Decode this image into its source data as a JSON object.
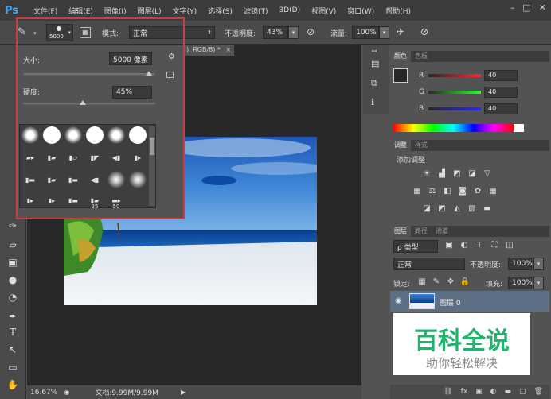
{
  "app": {
    "logo": "Ps"
  },
  "menu": [
    "文件(F)",
    "编辑(E)",
    "图像(I)",
    "图层(L)",
    "文字(Y)",
    "选择(S)",
    "滤镜(T)",
    "3D(D)",
    "视图(V)",
    "窗口(W)",
    "帮助(H)"
  ],
  "window_controls": [
    "–",
    "□",
    "✕"
  ],
  "options": {
    "brush_size": "5000",
    "mode_label": "模式:",
    "mode_value": "正常",
    "opacity_label": "不透明度:",
    "opacity_value": "43%",
    "flow_label": "流量:",
    "flow_value": "100%"
  },
  "document": {
    "tab_label": "), RGB/8) *",
    "zoom": "16.67%",
    "doc_info": "文档:9.99M/9.99M"
  },
  "brush_popup": {
    "size_label": "大小:",
    "size_value": "5000 像素",
    "size_level": 0.95,
    "hardness_label": "硬度:",
    "hardness_value": "45%",
    "hardness_level": 0.45,
    "grid_labels": [
      "25",
      "50"
    ]
  },
  "color_panel": {
    "tabs": [
      "颜色",
      "色板"
    ],
    "channels": [
      {
        "name": "R",
        "value": "40"
      },
      {
        "name": "G",
        "value": "40"
      },
      {
        "name": "B",
        "value": "40"
      }
    ]
  },
  "adjust_panel": {
    "tabs": [
      "调整",
      "样式"
    ],
    "title": "添加调整"
  },
  "layers_panel": {
    "tabs": [
      "图层",
      "路径",
      "通道"
    ],
    "filter_label": "ρ 类型",
    "blend_mode": "正常",
    "opacity_label": "不透明度:",
    "opacity_value": "100%",
    "lock_label": "锁定:",
    "fill_label": "填充:",
    "fill_value": "100%",
    "layer_name": "图层 0"
  },
  "watermark": {
    "title": "百科全说",
    "subtitle": "助你轻松解决"
  },
  "colors": {
    "highlight": "#d03b3b",
    "watermark_green": "#1fb36b"
  }
}
